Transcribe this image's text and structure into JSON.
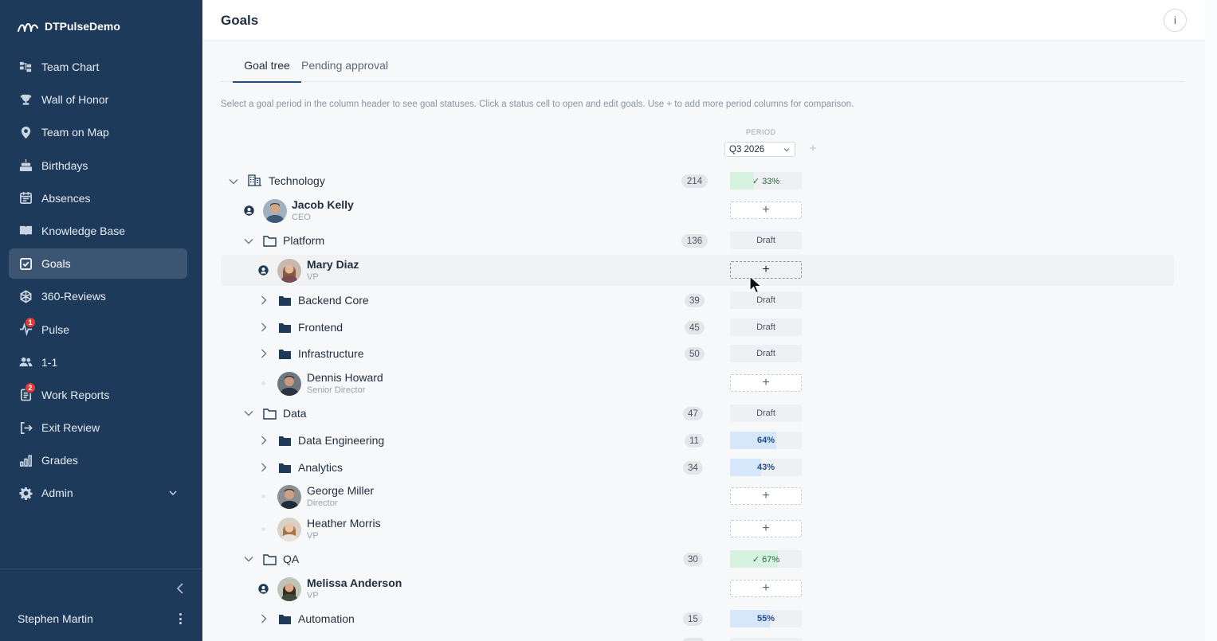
{
  "brand": {
    "name": "DTPulseDemo"
  },
  "sidebar": {
    "items": [
      {
        "label": "Team Chart",
        "icon": "team-chart-icon"
      },
      {
        "label": "Wall of Honor",
        "icon": "trophy-icon"
      },
      {
        "label": "Team on Map",
        "icon": "map-pin-icon"
      },
      {
        "label": "Birthdays",
        "icon": "cake-icon"
      },
      {
        "label": "Absences",
        "icon": "calendar-icon"
      },
      {
        "label": "Knowledge Base",
        "icon": "book-icon"
      },
      {
        "label": "Goals",
        "icon": "checkbox-icon",
        "active": true
      },
      {
        "label": "360-Reviews",
        "icon": "network-icon"
      },
      {
        "label": "Pulse",
        "icon": "pulse-icon",
        "badge": "1"
      },
      {
        "label": "1-1",
        "icon": "people-icon"
      },
      {
        "label": "Work Reports",
        "icon": "report-icon",
        "badge": "2"
      },
      {
        "label": "Exit Review",
        "icon": "exit-icon"
      },
      {
        "label": "Grades",
        "icon": "bar-chart-icon"
      },
      {
        "label": "Admin",
        "icon": "gear-icon",
        "has_chevron": true
      }
    ],
    "user_name": "Stephen Martin"
  },
  "header": {
    "title": "Goals",
    "info_label": "i"
  },
  "tabs": [
    {
      "label": "Goal tree",
      "active": true
    },
    {
      "label": "Pending approval",
      "active": false
    }
  ],
  "helper_text": "Select a goal period in the column header to see goal statuses. Click a status cell to open and edit goals. Use + to add more period columns for comparison.",
  "period": {
    "label": "PERIOD",
    "value": "Q3 2026",
    "add_label": "+"
  },
  "add_symbol": "+",
  "tree": {
    "technology": {
      "name": "Technology",
      "count": "214",
      "status": "33%",
      "progress": 0.33,
      "status_color": "#d7f3df"
    },
    "jacob": {
      "name": "Jacob Kelly",
      "title": "CEO"
    },
    "platform": {
      "name": "Platform",
      "count": "136",
      "status": "Draft"
    },
    "mary": {
      "name": "Mary Diaz",
      "title": "VP"
    },
    "backend": {
      "name": "Backend Core",
      "count": "39",
      "status": "Draft"
    },
    "frontend": {
      "name": "Frontend",
      "count": "45",
      "status": "Draft"
    },
    "infrastructure": {
      "name": "Infrastructure",
      "count": "50",
      "status": "Draft"
    },
    "dennis": {
      "name": "Dennis Howard",
      "title": "Senior Director"
    },
    "data": {
      "name": "Data",
      "count": "47",
      "status": "Draft"
    },
    "data_engineering": {
      "name": "Data Engineering",
      "count": "11",
      "status": "64%",
      "progress": 0.64,
      "status_color": "#d6e6fb"
    },
    "analytics": {
      "name": "Analytics",
      "count": "34",
      "status": "43%",
      "progress": 0.43,
      "status_color": "#d6e6fb"
    },
    "george": {
      "name": "George Miller",
      "title": "Director"
    },
    "heather": {
      "name": "Heather Morris",
      "title": "VP"
    },
    "qa": {
      "name": "QA",
      "count": "30",
      "status": "67%",
      "progress": 0.67,
      "status_color": "#d7f3df"
    },
    "melissa": {
      "name": "Melissa Anderson",
      "title": "VP"
    },
    "automation": {
      "name": "Automation",
      "count": "15",
      "status": "55%",
      "progress": 0.55,
      "status_color": "#d6e6fb"
    }
  }
}
